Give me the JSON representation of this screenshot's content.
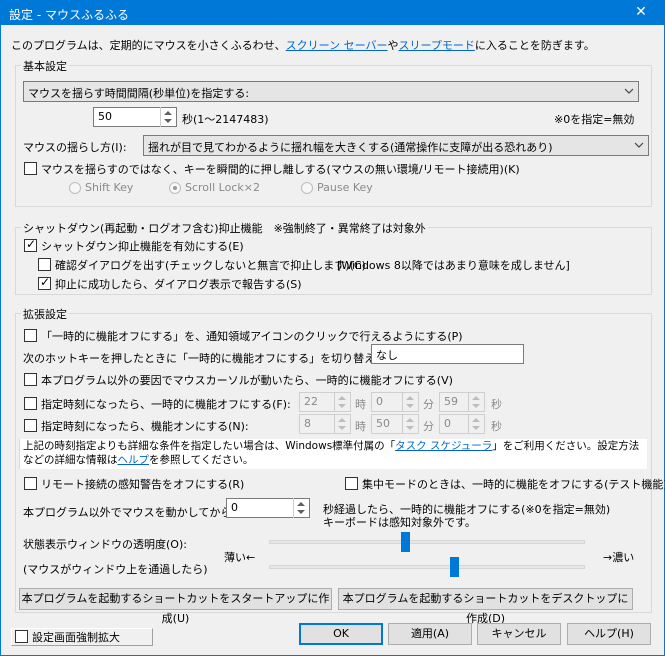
{
  "window": {
    "title": "設定 - マウスふるふる",
    "close_glyph": "✕"
  },
  "intro": {
    "pre": "このプログラムは、定期的にマウスを小さくふるわせ、",
    "link1": "スクリーン セーバー",
    "mid": "や",
    "link2": "スリープモード",
    "post": "に入ることを防ぎます。"
  },
  "basic": {
    "label": "基本設定",
    "interval_combo": "マウスを揺らす時間間隔(秒単位)を指定する:",
    "seconds_value": "50",
    "seconds_unit": "秒(1〜2147483)",
    "zero_note": "※0を指定=無効",
    "shake_label": "マウスの揺らし方(I):",
    "shake_combo": "揺れが目で見てわかるように揺れ幅を大きくする(通常操作に支障が出る恐れあり)",
    "key_check": "マウスを揺らすのではなく、キーを瞬間的に押し離しする(マウスの無い環境/リモート接続用)(K)",
    "radios": [
      "Shift Key",
      "Scroll Lock×2",
      "Pause Key"
    ]
  },
  "shutdown": {
    "label": "シャットダウン(再起動・ログオフ含む)抑止機能",
    "note": "※強制終了・異常終了は対象外",
    "enable": "シャットダウン抑止機能を有効にする(E)",
    "confirm": "確認ダイアログを出す(チェックしないと無言で抑止します)(C)",
    "win8_note": "[Windows 8以降ではあまり意味を成しません]",
    "report": "抑止に成功したら、ダイアログ表示で報告する(S)"
  },
  "extended": {
    "label": "拡張設定",
    "tray_click": "「一時的に機能オフにする」を、通知領域アイコンのクリックで行えるようにする(P)",
    "hotkey_label": "次のホットキーを押したときに「一時的に機能オフにする」を切り替える:",
    "hotkey_value": "なし",
    "cursor_move": "本プログラム以外の要因でマウスカーソルが動いたら、一時的に機能オフにする(V)",
    "time_off": "指定時刻になったら、一時的に機能オフにする(F):",
    "time_on": "指定時刻になったら、機能オンにする(N):",
    "off_h": "22",
    "off_m": "0",
    "off_s": "59",
    "on_h": "8",
    "on_m": "50",
    "on_s": "0",
    "hour_unit": "時",
    "minute_unit": "分",
    "second_unit": "秒",
    "info_pre": "上記の時刻指定よりも詳細な条件を指定したい場合は、Windows標準付属の「",
    "info_link1": "タスク スケジューラ",
    "info_mid": "」をご利用ください。設定方法などの詳細な情報は",
    "info_link2": "ヘルプ",
    "info_post": "を参照してください。",
    "remote": "リモート接続の感知警告をオフにする(R)",
    "focus": "集中モードのときは、一時的に機能をオフにする(テスト機能)",
    "idle_label": "本プログラム以外でマウスを動かしてから",
    "idle_value": "0",
    "idle_after1": "秒経過したら、一時的に機能オフにする(※0を指定=無効)",
    "idle_after2": "キーボードは感知対象外です。",
    "opacity_label": "状態表示ウィンドウの透明度(O):",
    "opacity_sub": "(マウスがウィンドウ上を通過したら)",
    "thin": "薄い←",
    "dark": "→濃い",
    "opacity_level": 0.43,
    "opacity_hover_level": 0.59,
    "startup_btn": "本プログラムを起動するショートカットをスタートアップに作成(U)",
    "desktop_btn": "本プログラムを起動するショートカットをデスクトップに作成(D)"
  },
  "footer": {
    "enlarge": "設定画面強制拡大",
    "ok": "OK",
    "apply": "適用(A)",
    "cancel": "キャンセル",
    "help": "ヘルプ(H)"
  }
}
